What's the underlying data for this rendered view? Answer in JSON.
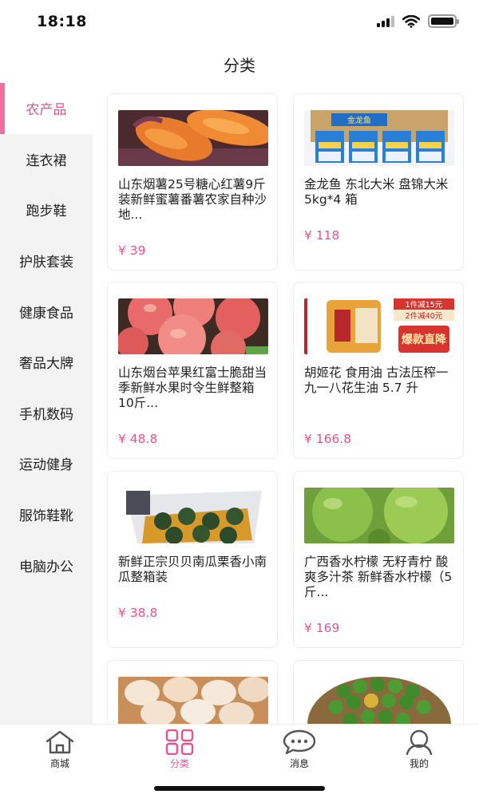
{
  "status": {
    "time": "18:18"
  },
  "header": {
    "title": "分类"
  },
  "colors": {
    "accent": "#e5538e",
    "sidebar_bg": "#f3f3f3"
  },
  "sidebar": {
    "items": [
      {
        "label": "农产品",
        "active": true
      },
      {
        "label": "连衣裙"
      },
      {
        "label": "跑步鞋"
      },
      {
        "label": "护肤套装"
      },
      {
        "label": "健康食品"
      },
      {
        "label": "奢品大牌"
      },
      {
        "label": "手机数码"
      },
      {
        "label": "运动健身"
      },
      {
        "label": "服饰鞋靴"
      },
      {
        "label": "电脑办公"
      }
    ]
  },
  "products": [
    {
      "title": "山东烟薯25号糖心红薯9斤装新鲜蜜薯番薯农家自种沙地...",
      "price": "¥ 39"
    },
    {
      "title": "金龙鱼 东北大米 盘锦大米 5kg*4 箱",
      "price": "¥ 118",
      "image_text": "金龙鱼"
    },
    {
      "title": "山东烟台苹果红富士脆甜当季新鲜水果时令生鲜整箱10斤...",
      "price": "¥ 48.8"
    },
    {
      "title": "胡姬花 食用油 古法压榨一九一八花生油 5.7 升",
      "price": "¥ 166.8",
      "image_texts": [
        "1件减15元",
        "2件减40元",
        "爆款直降"
      ]
    },
    {
      "title": "新鲜正宗贝贝南瓜栗香小南瓜整箱装",
      "price": "¥ 38.8"
    },
    {
      "title": "广西香水柠檬 无籽青柠 酸爽多汁茶 新鲜香水柠檬（5斤...",
      "price": "¥ 169"
    },
    {
      "title": "",
      "price": ""
    },
    {
      "title": "",
      "price": ""
    }
  ],
  "tabbar": {
    "tabs": [
      {
        "label": "商城",
        "icon": "home-icon"
      },
      {
        "label": "分类",
        "icon": "grid-icon",
        "active": true
      },
      {
        "label": "消息",
        "icon": "chat-icon"
      },
      {
        "label": "我的",
        "icon": "user-icon"
      }
    ]
  }
}
